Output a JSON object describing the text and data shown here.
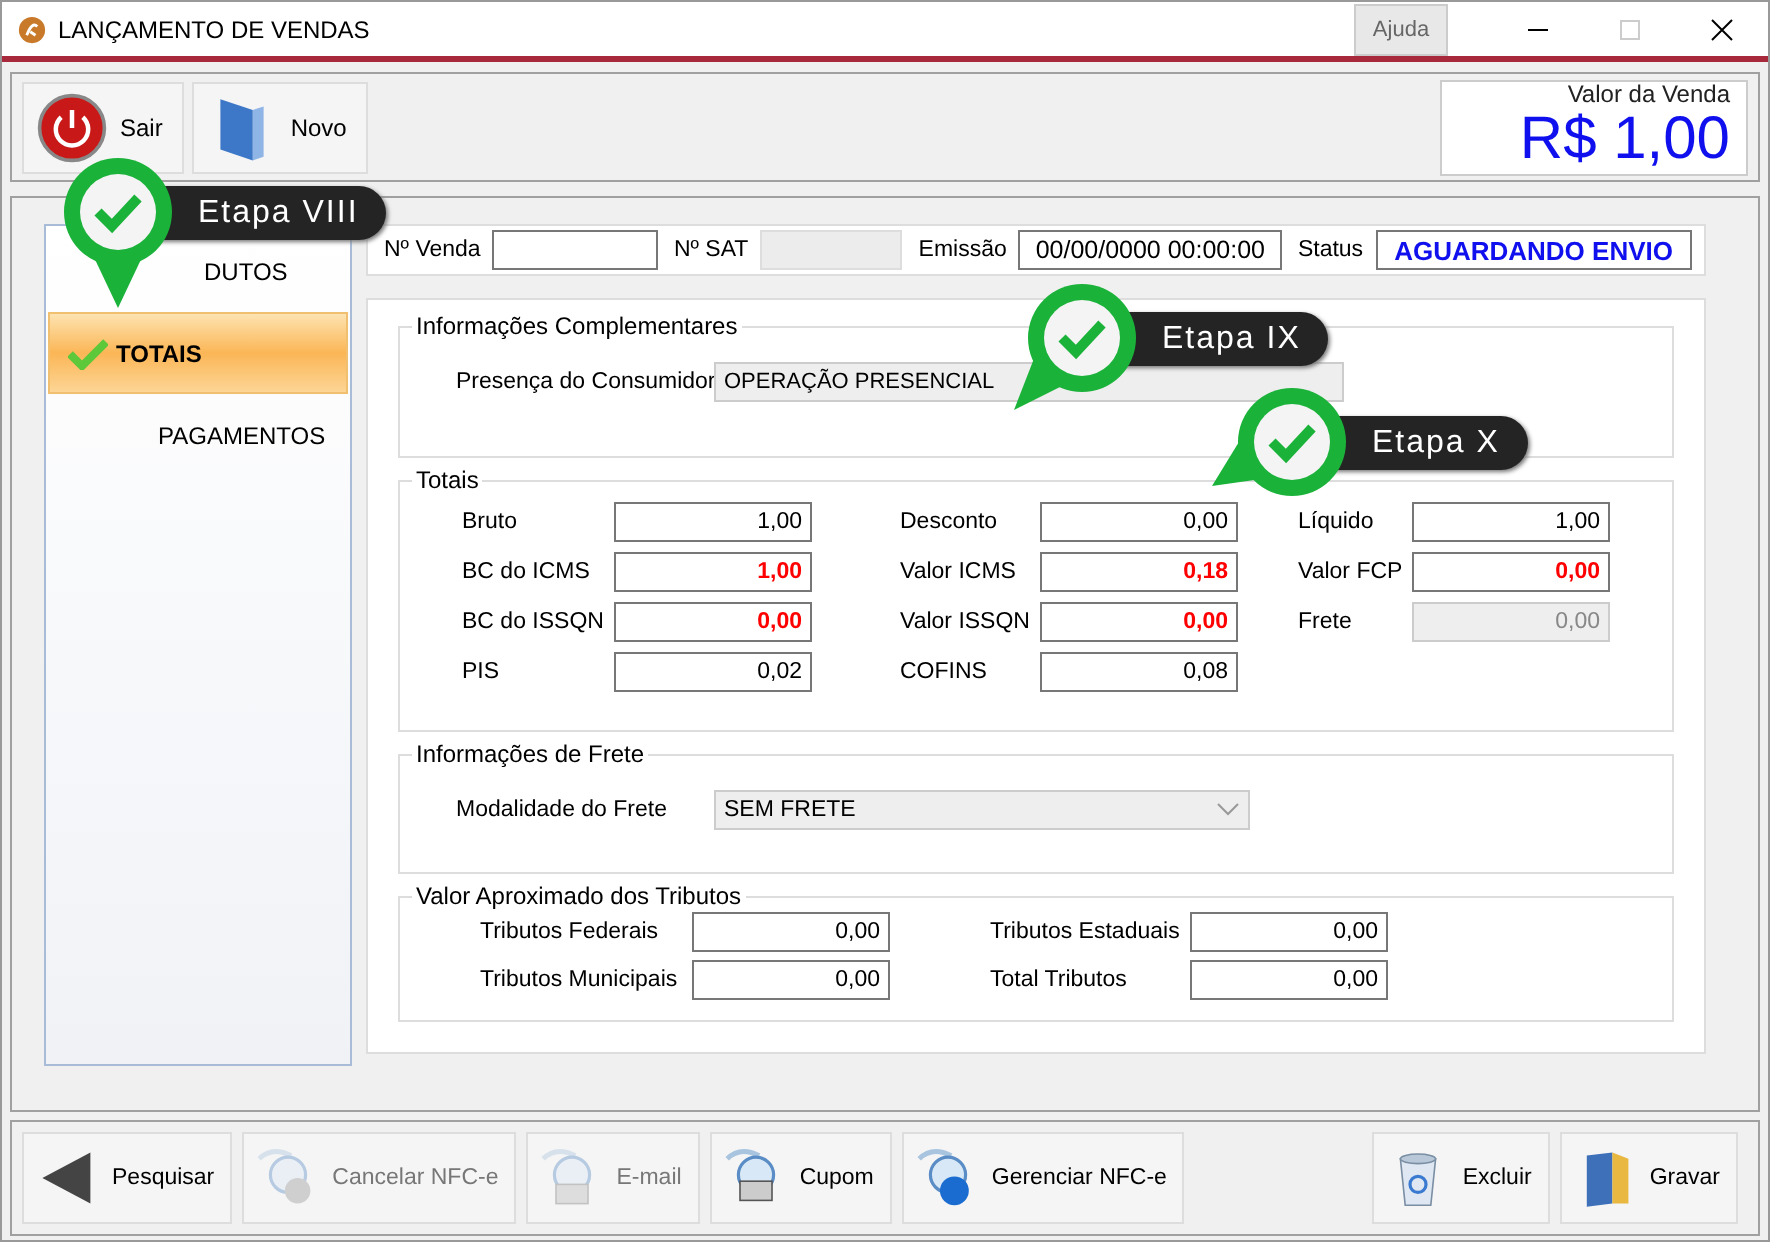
{
  "window": {
    "title": "LANÇAMENTO DE VENDAS",
    "help_tab": "Ajuda"
  },
  "top_buttons": [
    {
      "label": "Sair"
    },
    {
      "label": "Novo"
    }
  ],
  "sale_value": {
    "label": "Valor da Venda",
    "value": "R$ 1,00"
  },
  "sidebar": {
    "items": [
      {
        "label": "DUTOS",
        "selected": false
      },
      {
        "label": "TOTAIS",
        "selected": true
      },
      {
        "label": "PAGAMENTOS",
        "selected": false
      }
    ]
  },
  "header_fields": [
    {
      "label": "Nº Venda",
      "disabled": false
    },
    {
      "label": "Nº SAT",
      "disabled": true
    },
    {
      "label": "Emissão",
      "disabled": false,
      "value": "00/00/0000 00:00:00"
    },
    {
      "label": "Status",
      "disabled": false,
      "value": "AGUARDANDO ENVIO",
      "kind": "status"
    }
  ],
  "complementares": {
    "title": "Informações Complementares",
    "label": "Presença do Consumidor",
    "value": "OPERAÇÃO PRESENCIAL"
  },
  "totais": {
    "title": "Totais",
    "rows": [
      [
        {
          "label": "Bruto",
          "value": "1,00",
          "highlight": false,
          "disabled": false
        },
        {
          "label": "Desconto",
          "value": "0,00",
          "highlight": false,
          "disabled": false
        },
        {
          "label": "Líquido",
          "value": "1,00",
          "highlight": false,
          "disabled": false
        }
      ],
      [
        {
          "label": "BC do ICMS",
          "value": "1,00",
          "highlight": true,
          "disabled": false
        },
        {
          "label": "Valor ICMS",
          "value": "0,18",
          "highlight": true,
          "disabled": false
        },
        {
          "label": "Valor FCP",
          "value": "0,00",
          "highlight": true,
          "disabled": false
        }
      ],
      [
        {
          "label": "BC do ISSQN",
          "value": "0,00",
          "highlight": true,
          "disabled": false
        },
        {
          "label": "Valor ISSQN",
          "value": "0,00",
          "highlight": true,
          "disabled": false
        },
        {
          "label": "Frete",
          "value": "0,00",
          "highlight": false,
          "disabled": true
        }
      ],
      [
        {
          "label": "PIS",
          "value": "0,02",
          "highlight": false,
          "disabled": false
        },
        {
          "label": "COFINS",
          "value": "0,08",
          "highlight": false,
          "disabled": false
        }
      ]
    ]
  },
  "frete": {
    "title": "Informações de Frete",
    "label": "Modalidade do Frete",
    "value": "SEM FRETE"
  },
  "tributos": {
    "title": "Valor Aproximado dos Tributos",
    "rows": [
      [
        {
          "label": "Tributos Federais",
          "value": "0,00"
        },
        {
          "label": "Tributos Estaduais",
          "value": "0,00"
        }
      ],
      [
        {
          "label": "Tributos Municipais",
          "value": "0,00"
        },
        {
          "label": "Total Tributos",
          "value": "0,00"
        }
      ]
    ]
  },
  "bottom_left_buttons": [
    {
      "label": "Pesquisar",
      "disabled": false
    },
    {
      "label": "Cancelar NFC-e",
      "disabled": true
    },
    {
      "label": "E-mail",
      "disabled": true
    },
    {
      "label": "Cupom",
      "disabled": false
    },
    {
      "label": "Gerenciar NFC-e",
      "disabled": false
    }
  ],
  "bottom_right_buttons": [
    {
      "label": "Excluir",
      "disabled": false
    },
    {
      "label": "Gravar",
      "disabled": false
    }
  ],
  "callouts": [
    {
      "label": "Etapa VIII"
    },
    {
      "label": "Etapa IX"
    },
    {
      "label": "Etapa X"
    }
  ]
}
